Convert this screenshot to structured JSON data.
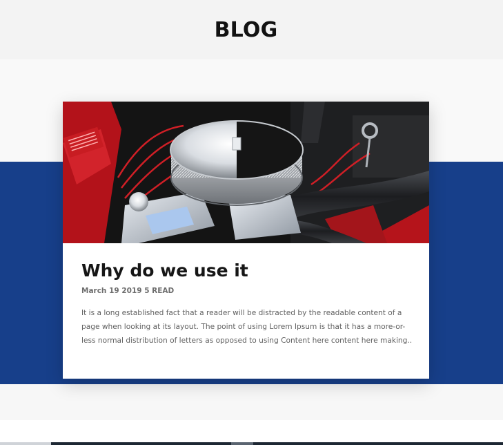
{
  "page": {
    "title": "BLOG"
  },
  "post": {
    "image_alt": "engine-photo",
    "title": "Why do we use it",
    "meta": "March 19 2019 5 READ",
    "excerpt": "It is a long established fact that a reader will be distracted by the readable content of a page when looking at its layout. The point of using Lorem Ipsum is that it has a more-or-less normal distribution of letters as opposed to using Content here content here making.."
  },
  "colors": {
    "accent_band": "#173f8a",
    "header_bg": "#f3f3f3",
    "title_text": "#111111"
  }
}
